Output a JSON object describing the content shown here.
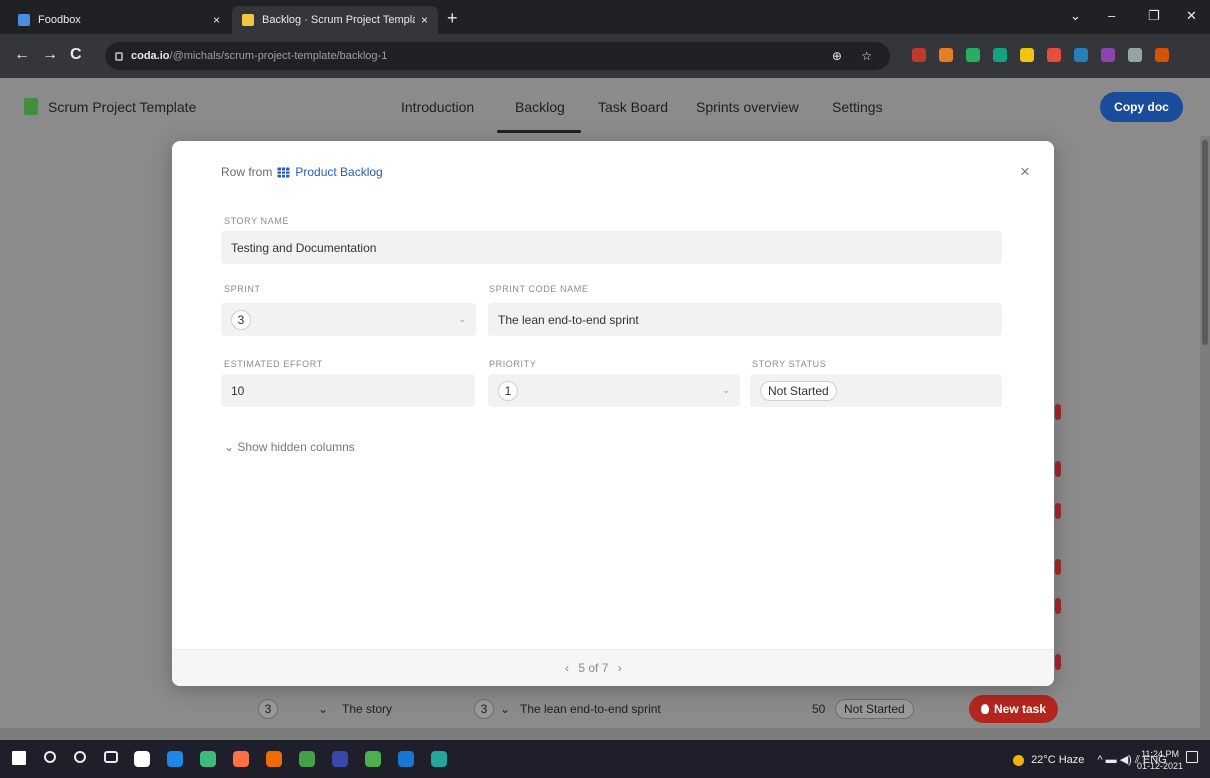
{
  "browser": {
    "tabs": [
      {
        "label": "Foodbox",
        "close": "×"
      },
      {
        "label": "Backlog · Scrum Project Template",
        "close": "×"
      }
    ],
    "new_tab": "+",
    "window_controls": {
      "minimize": "–",
      "restore": "❐",
      "close": "✕",
      "menu": "⌄"
    },
    "nav": {
      "back": "←",
      "forward": "→",
      "reload": "C"
    },
    "address": {
      "host": "coda.io",
      "path": "/@michals/scrum-project-template/backlog-1"
    },
    "omnibox_icons": "⊕ ☆",
    "extension_colors": [
      "#c0392b",
      "#e67e22",
      "#27ae60",
      "#16a085",
      "#f1c40f",
      "#e74c3c",
      "#2980b9",
      "#8e44ad",
      "#95a5a6",
      "#d35400"
    ]
  },
  "doc": {
    "title": "Scrum Project Template",
    "nav_tabs": [
      "Introduction",
      "Backlog",
      "Task Board",
      "Sprints overview",
      "Settings"
    ],
    "active_tab": "Backlog",
    "copy_doc": "Copy doc"
  },
  "modal": {
    "row_from_prefix": "Row from",
    "table_name": "Product Backlog",
    "close": "×",
    "fields": {
      "story_name": {
        "label": "STORY NAME",
        "value": "Testing and Documentation"
      },
      "sprint": {
        "label": "SPRINT",
        "value": "3"
      },
      "sprint_code_name": {
        "label": "SPRINT CODE NAME",
        "value": "The lean end-to-end sprint"
      },
      "estimated_effort": {
        "label": "ESTIMATED EFFORT",
        "value": "10"
      },
      "priority": {
        "label": "PRIORITY",
        "value": "1"
      },
      "story_status": {
        "label": "STORY STATUS",
        "value": "Not Started"
      }
    },
    "dropdown_caret": "⌄",
    "show_hidden": "⌄  Show hidden columns",
    "pager": {
      "prev": "‹",
      "text": "5 of 7",
      "next": "›"
    }
  },
  "background_row": {
    "sprint": "3",
    "caret": "⌄",
    "story": "The story",
    "sprint2": "3",
    "sprint_code": "The lean end-to-end sprint",
    "effort": "50",
    "status": "Not Started",
    "new_task": "New task"
  },
  "taskbar": {
    "weather": "22°C  Haze",
    "tray": "^  ▬  ◀)  ⫽  ENG",
    "time": "11:24 PM",
    "date": "01-12-2021",
    "app_colors": [
      "#ffffff",
      "#1e88e5",
      "#3dbb7a",
      "#ff7043",
      "#ef6c00",
      "#43a047",
      "#3949ab",
      "#4caf50",
      "#1976d2",
      "#26a69a"
    ]
  }
}
